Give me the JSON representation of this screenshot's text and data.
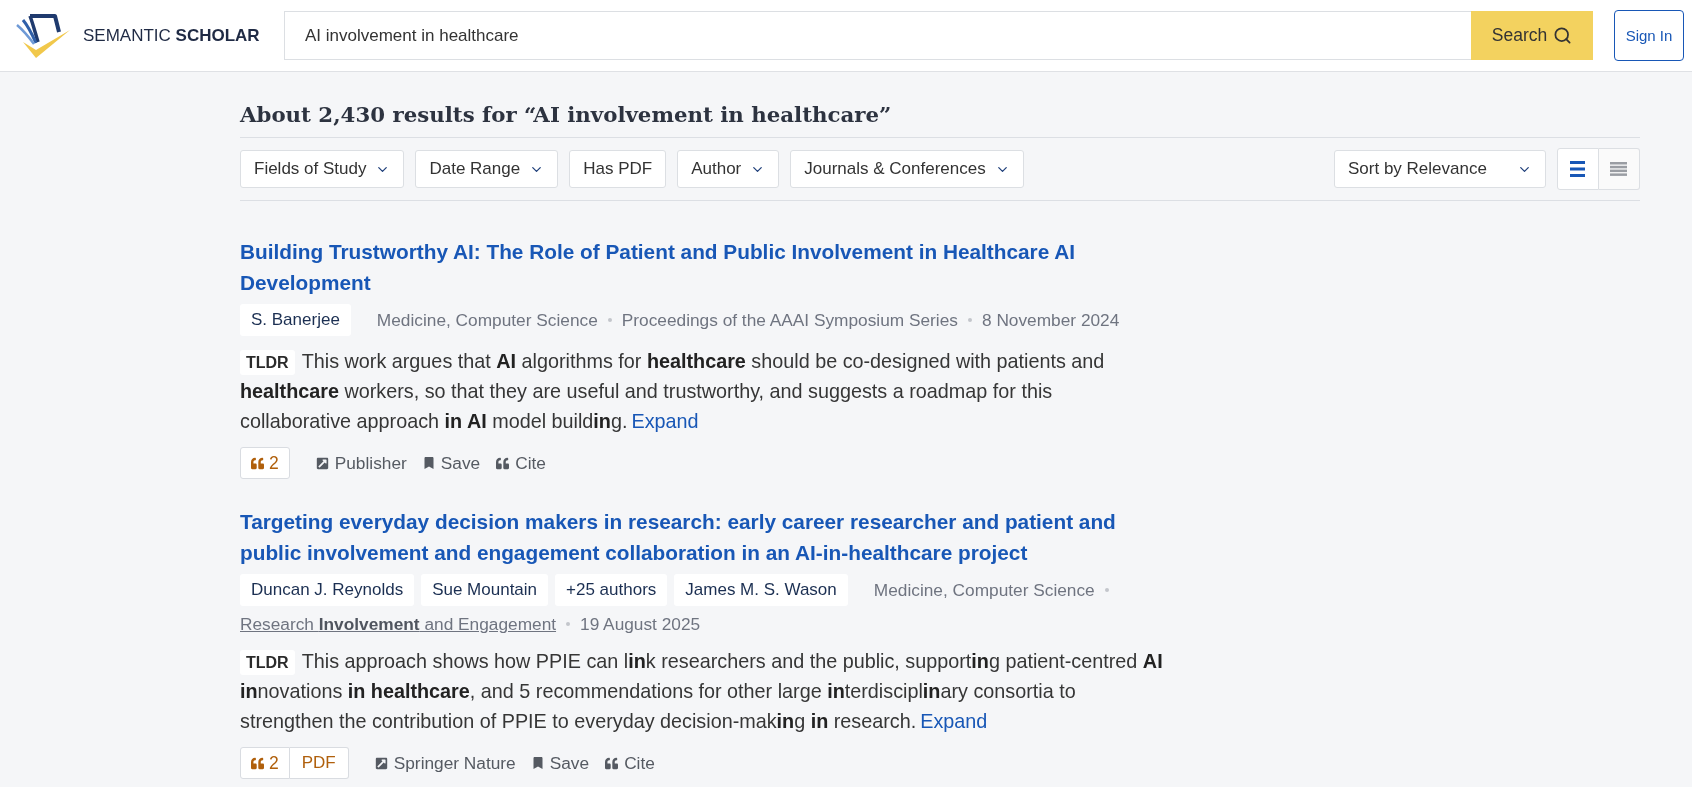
{
  "header": {
    "logo_text": "SEMANTIC **SCHOLAR**",
    "search": {
      "value": "AI involvement in healthcare"
    },
    "search_button": "Search",
    "sign_in": "Sign In"
  },
  "results_summary": "About 2,430 results for “AI involvement in healthcare”",
  "filters": [
    {
      "label": "Fields of Study",
      "kind": "dropdown"
    },
    {
      "label": "Date Range",
      "kind": "dropdown"
    },
    {
      "label": "Has PDF",
      "kind": "toggle"
    },
    {
      "label": "Author",
      "kind": "dropdown"
    },
    {
      "label": "Journals & Conferences",
      "kind": "dropdown"
    }
  ],
  "sort": {
    "label": "Sort by Relevance"
  },
  "view_modes": [
    {
      "kind": "standard",
      "selected": true
    },
    {
      "kind": "condensed",
      "selected": false
    }
  ],
  "papers": [
    {
      "title": "Building Trustworthy AI: The Role of Patient and Public Involvement in Healthcare AI Development",
      "authors": [
        "S. Banerjee"
      ],
      "fields": "Medicine, Computer Science",
      "venue": {
        "name": "Proceedings of the AAAI Symposium Series",
        "link": false
      },
      "date": "8 November 2024",
      "tldr_label": "TLDR",
      "tldr": "This work argues that **AI** algorithms for **healthcare** should be co-designed with patients and **healthcare** workers, so that they are useful and trustworthy, and suggests a roadmap for this collaborative approach **in AI** model build**in**g.",
      "expand": "Expand",
      "citations": "2",
      "actions": [
        {
          "kind": "publisher",
          "label": "Publisher"
        },
        {
          "kind": "save",
          "label": "Save"
        },
        {
          "kind": "cite",
          "label": "Cite"
        }
      ]
    },
    {
      "title": "Targeting everyday decision makers in research: early career researcher and patient and public involvement and engagement collaboration in an AI-in-healthcare project",
      "authors": [
        "Duncan J. Reynolds",
        "Sue Mountain",
        "+25 authors",
        "James M. S. Wason"
      ],
      "fields": "Medicine, Computer Science",
      "venue": {
        "name": "Research **Involvement** and Engagement",
        "link": true
      },
      "date": "19 August 2025",
      "tldr_label": "TLDR",
      "tldr": "This approach shows how PPIE can l**in**k researchers and the public, support**in**g patient-centred **AI** **in**novations **in healthcare**, and 5 recommendations for other large **in**terdiscipl**in**ary consortia to strengthen the contribution of PPIE to everyday decision-mak**in**g **in** research.",
      "expand": "Expand",
      "citations": "2",
      "pdf": "PDF",
      "actions": [
        {
          "kind": "publisher",
          "label": "Springer Nature"
        },
        {
          "kind": "save",
          "label": "Save"
        },
        {
          "kind": "cite",
          "label": "Cite"
        }
      ]
    }
  ]
}
